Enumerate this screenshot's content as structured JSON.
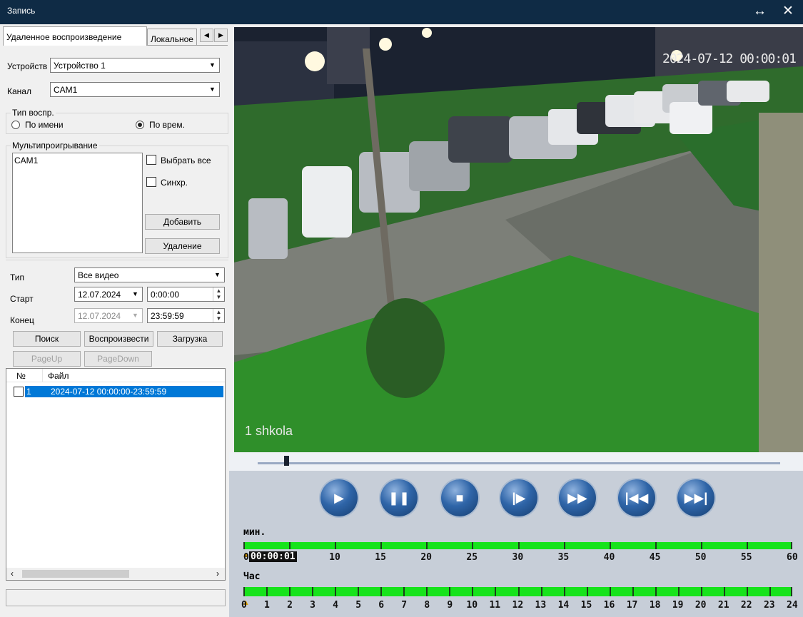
{
  "window": {
    "title": "Запись",
    "resize_glyph": "↔",
    "close_glyph": "✕"
  },
  "tabs": {
    "remote": "Удаленное воспроизведение",
    "local": "Локальное",
    "left_arrow": "◀",
    "right_arrow": "▶"
  },
  "device": {
    "label": "Устройств",
    "value": "Устройство 1"
  },
  "channel": {
    "label": "Канал",
    "value": "CAM1"
  },
  "play_type": {
    "group": "Тип воспр.",
    "by_name": "По имени",
    "by_time": "По врем.",
    "selected": "by_time"
  },
  "multi": {
    "group": "Мультипроигрывание",
    "items": [
      "CAM1"
    ],
    "select_all": "Выбрать все",
    "sync": "Синхр.",
    "add": "Добавить",
    "delete": "Удаление"
  },
  "filter": {
    "type_label": "Тип",
    "type_value": "Все видео",
    "start_label": "Старт",
    "start_date": "12.07.2024",
    "start_time": "0:00:00",
    "end_label": "Конец",
    "end_date": "12.07.2024",
    "end_time": "23:59:59"
  },
  "actions": {
    "search": "Поиск",
    "play": "Воспроизвести",
    "download": "Загрузка",
    "page_up": "PageUp",
    "page_down": "PageDown"
  },
  "file_table": {
    "col_no": "№",
    "col_file": "Файл",
    "rows": [
      {
        "no": "1",
        "file": "2024-07-12 00:00:00-23:59:59"
      }
    ]
  },
  "video": {
    "timestamp": "2024-07-12 00:00:01",
    "camera_label": "1 shkola",
    "progress": 0.05
  },
  "playback_buttons": [
    {
      "name": "play-button",
      "glyph": "▶"
    },
    {
      "name": "pause-button",
      "glyph": "❚❚"
    },
    {
      "name": "stop-button",
      "glyph": "■"
    },
    {
      "name": "step-button",
      "glyph": "|▶"
    },
    {
      "name": "fast-forward-button",
      "glyph": "▶▶"
    },
    {
      "name": "previous-button",
      "glyph": "|◀◀"
    },
    {
      "name": "next-button",
      "glyph": "▶▶|"
    }
  ],
  "timeline": {
    "minutes_label": "мин.",
    "minute_current": "00:00:01",
    "minute_ticks": [
      "0",
      "10",
      "15",
      "20",
      "25",
      "30",
      "35",
      "40",
      "45",
      "50",
      "55",
      "60"
    ],
    "hours_label": "Час",
    "hour_ticks": [
      "0",
      "1",
      "2",
      "3",
      "4",
      "5",
      "6",
      "7",
      "8",
      "9",
      "10",
      "11",
      "12",
      "13",
      "14",
      "15",
      "16",
      "17",
      "18",
      "19",
      "20",
      "21",
      "22",
      "23",
      "24"
    ]
  },
  "colors": {
    "title_bar": "#0f2b45",
    "timeline": "#16e31b",
    "selection": "#0078d7"
  }
}
